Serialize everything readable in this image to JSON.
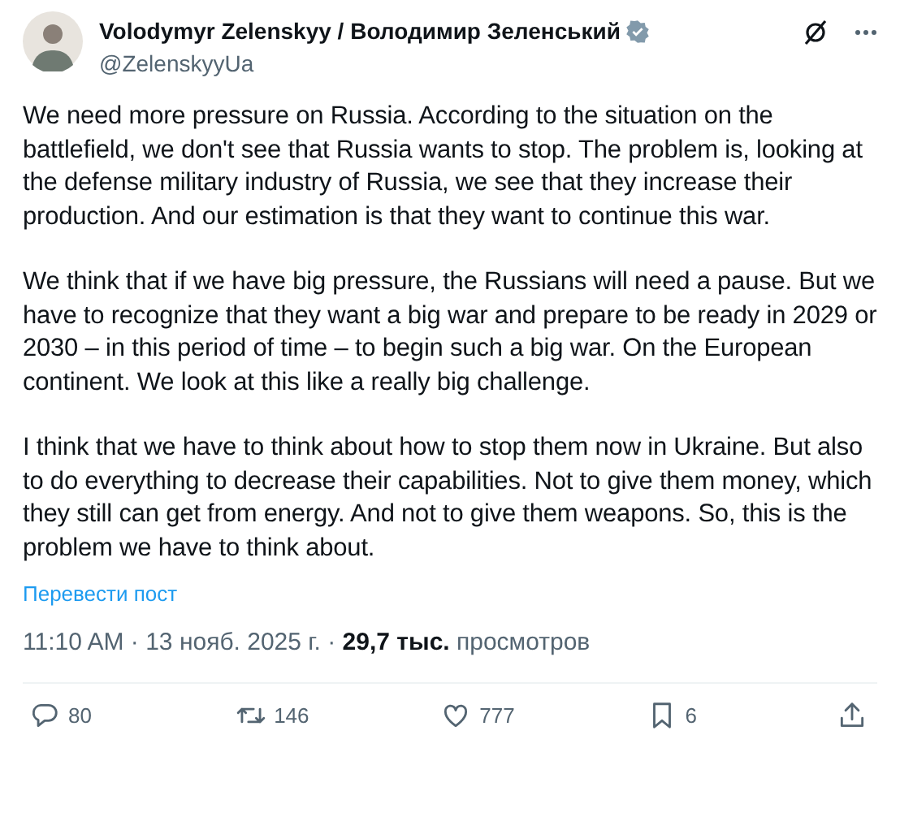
{
  "author": {
    "name": "Volodymyr Zelenskyy / Володимир Зеленський",
    "verified": true,
    "handle": "@ZelenskyyUa"
  },
  "paragraphs": [
    "We need more pressure on Russia. According to the situation on the battlefield, we don't see that Russia wants to stop. The problem is, looking at the defense military industry of Russia, we see that they increase their production. And our estimation is that they want to continue this war.",
    "We think that if we have big pressure, the Russians will need a pause. But we have to recognize that they want a big war and prepare to be ready in 2029 or 2030 – in this period of time – to begin such a big war. On the European continent. We look at this like a really big challenge.",
    "I think that we have to think about how to stop them now in Ukraine. But also to do everything to decrease their capabilities. Not to give them money, which they still can get from energy. And not to give them weapons. So, this is the problem we have to think about."
  ],
  "translate_link": "Перевести пост",
  "meta": "11:10 AM · 13 нояб. 2025 г. · **29,7 тыс.** просмотров",
  "actions": [
    {
      "kind": "reply",
      "count": "80"
    },
    {
      "kind": "repost",
      "count": "146"
    },
    {
      "kind": "like",
      "count": "777"
    },
    {
      "kind": "bookmark",
      "count": "6"
    },
    {
      "kind": "share"
    }
  ]
}
